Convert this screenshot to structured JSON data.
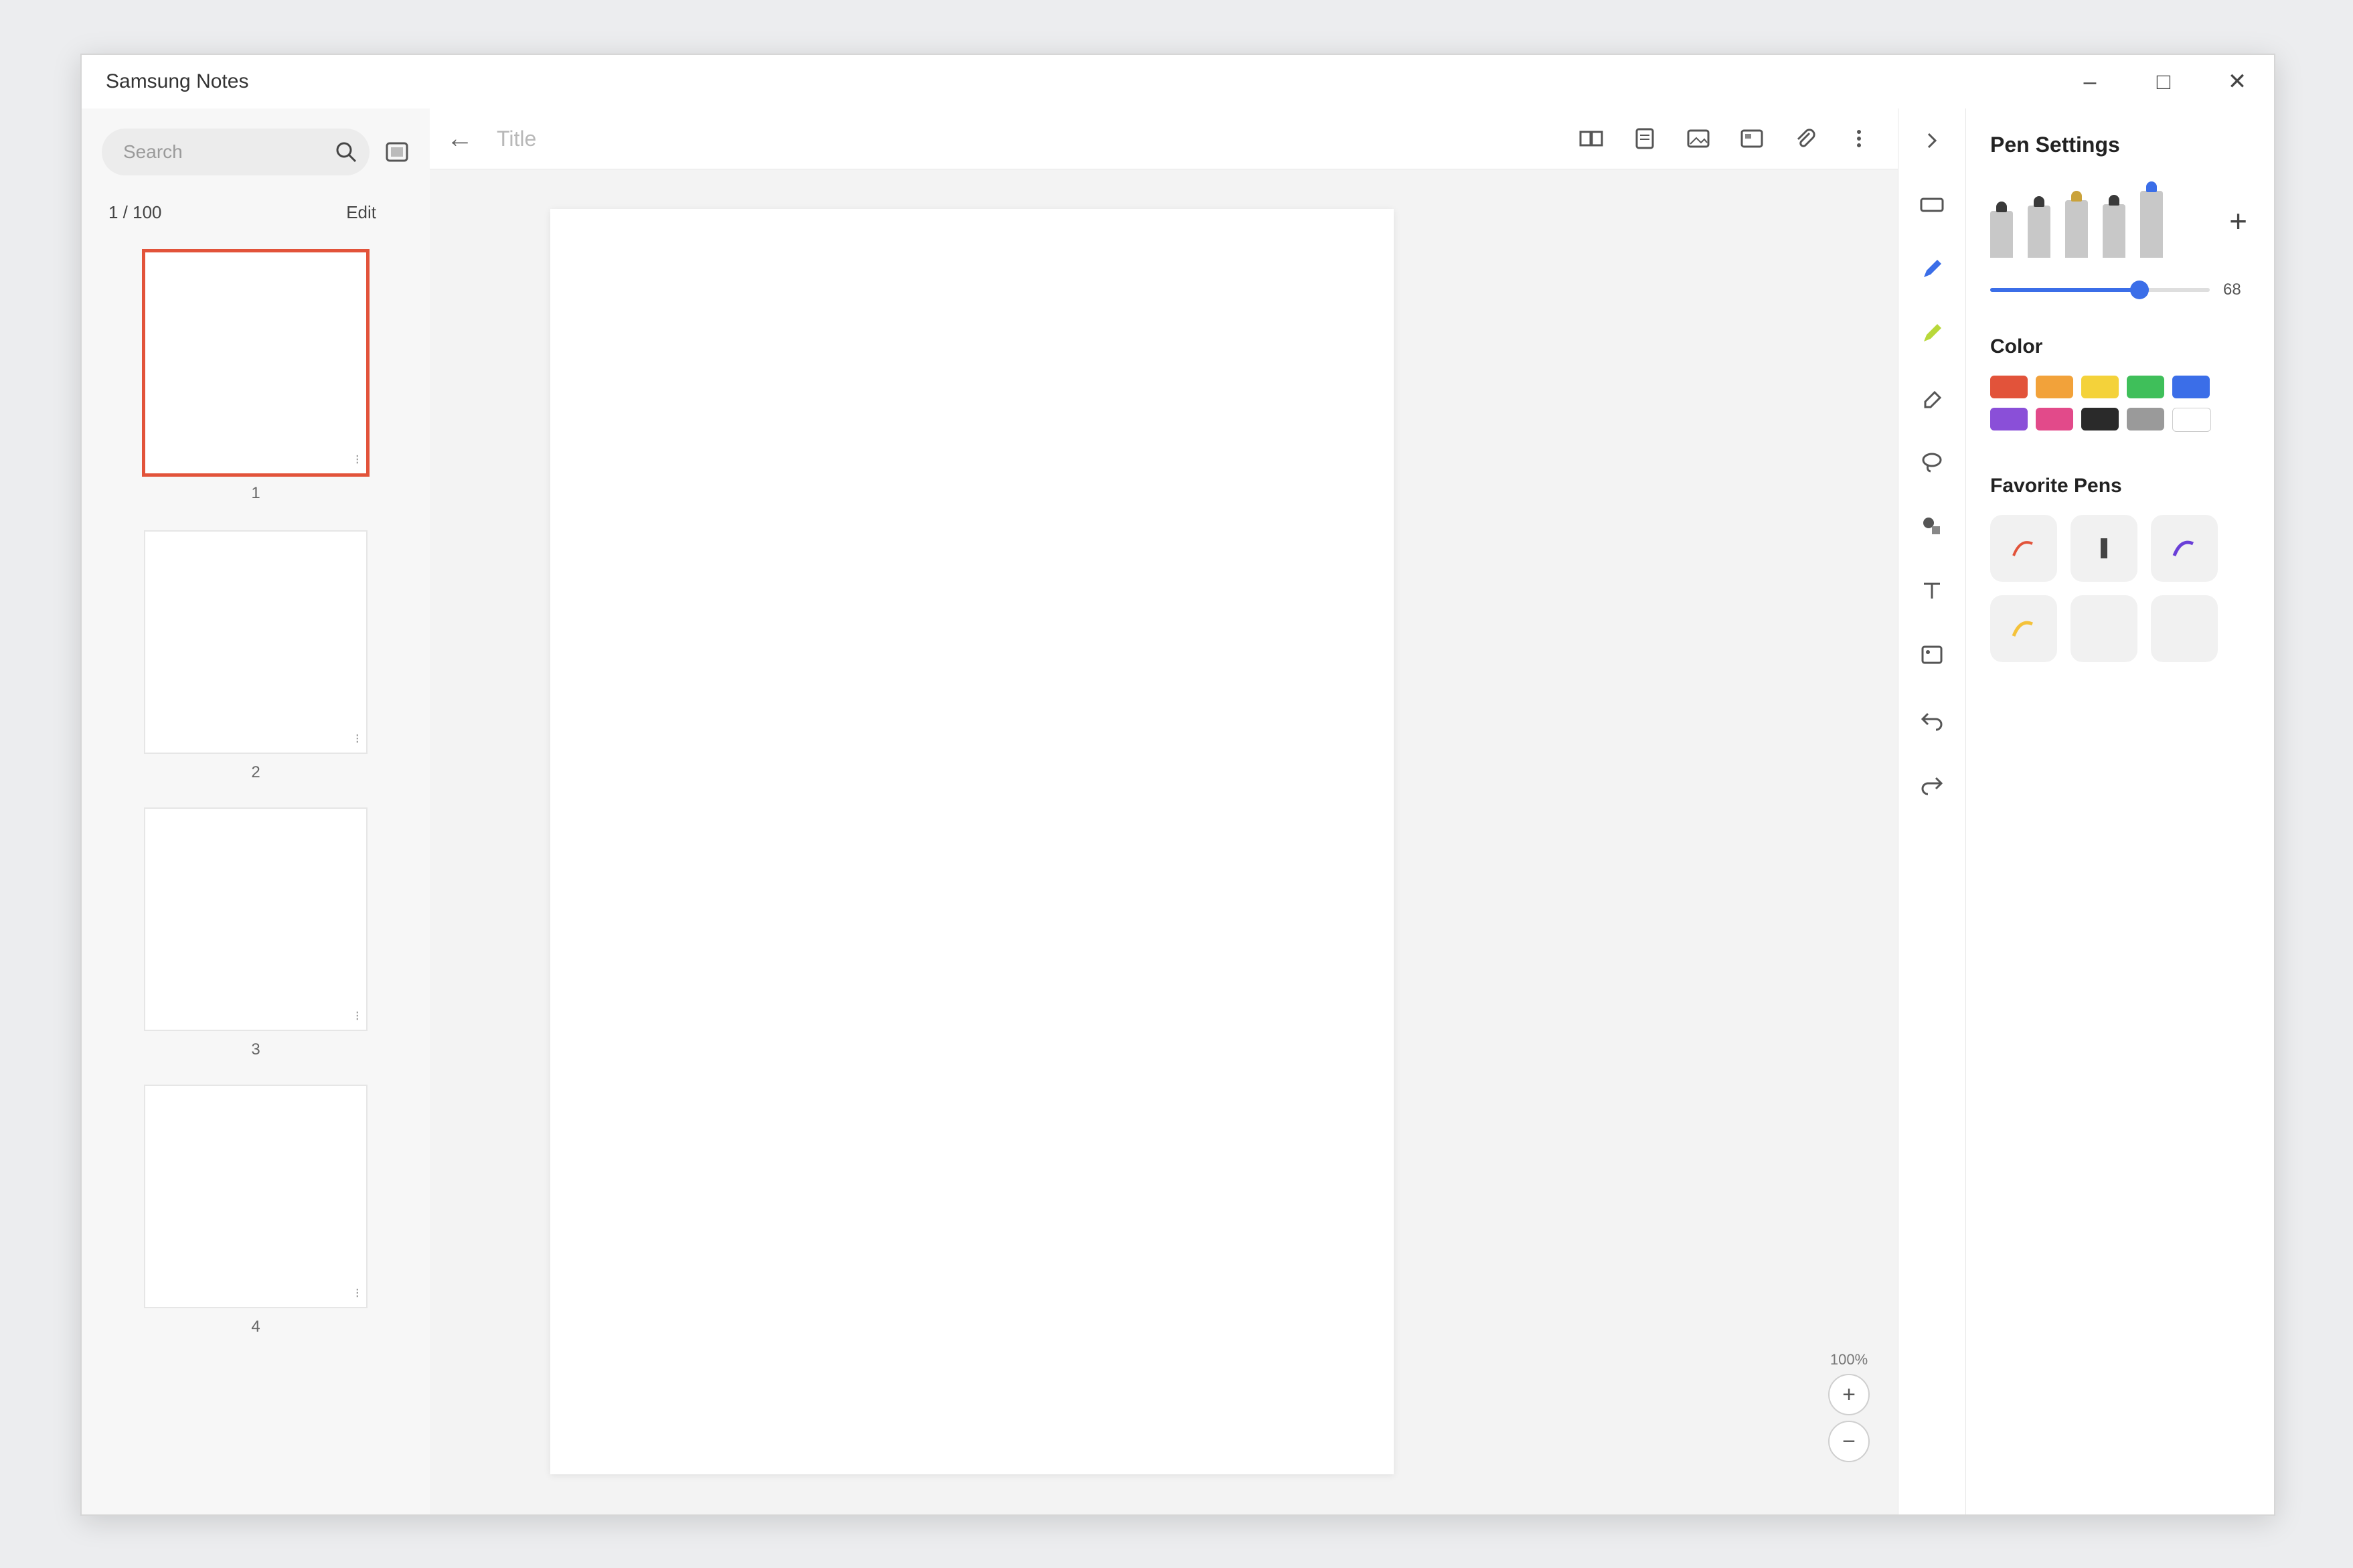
{
  "app": {
    "title": "Samsung Notes"
  },
  "window_controls": {
    "minimize": "–",
    "maximize": "□",
    "close": "✕"
  },
  "sidebar": {
    "search_placeholder": "Search",
    "page_count": "1 / 100",
    "edit_label": "Edit",
    "pages": [
      {
        "number": "1"
      },
      {
        "number": "2"
      },
      {
        "number": "3"
      },
      {
        "number": "4"
      }
    ]
  },
  "note": {
    "back_arrow": "←",
    "title_placeholder": "Title"
  },
  "zoom": {
    "level": "100%",
    "plus": "+",
    "minus": "−"
  },
  "pen_settings": {
    "title": "Pen Settings",
    "add_label": "+",
    "size_value": "68",
    "size_fraction": 0.68,
    "pens": [
      {
        "name": "fountain-pen",
        "tip": "#3a3a3a"
      },
      {
        "name": "pen",
        "tip": "#3a3a3a"
      },
      {
        "name": "pencil",
        "tip": "#caa23a"
      },
      {
        "name": "brush",
        "tip": "#3a3a3a"
      },
      {
        "name": "highlighter",
        "tip": "#3b6ee8"
      }
    ],
    "color_title": "Color",
    "colors": [
      "#e2533a",
      "#f2a23a",
      "#f4d23a",
      "#3fbf5a",
      "#3b6ee8",
      "#8a4fd8",
      "#e24a8a",
      "#2a2a2a",
      "#9a9a9a",
      "#ffffff"
    ],
    "favorite_title": "Favorite Pens"
  },
  "rail_icons": [
    "pen-icon",
    "highlighter-icon",
    "eraser-icon",
    "lasso-icon",
    "shape-icon",
    "text-icon",
    "image-icon",
    "undo-icon",
    "redo-icon"
  ],
  "toolbar_icons": [
    "book-view-icon",
    "page-icon",
    "image-insert-icon",
    "template-icon",
    "attachment-icon",
    "more-icon"
  ]
}
